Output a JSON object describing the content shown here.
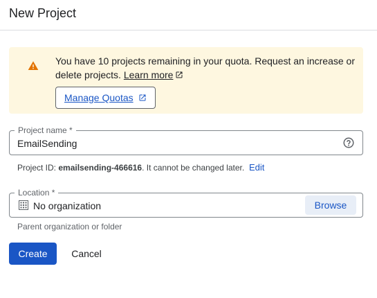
{
  "header": {
    "title": "New Project"
  },
  "quota_banner": {
    "message": "You have 10 projects remaining in your quota. Request an increase or delete projects.",
    "learn_more_label": "Learn more",
    "manage_quotas_label": "Manage Quotas",
    "icon": "warning-icon",
    "icon_color": "#e37400"
  },
  "project_name": {
    "label": "Project name *",
    "value": "EmailSending",
    "help_icon": "help-circle-icon"
  },
  "project_id": {
    "prefix": "Project ID: ",
    "id": "emailsending-466616",
    "suffix": ". It cannot be changed later.",
    "edit_label": "Edit"
  },
  "location": {
    "label": "Location *",
    "value": "No organization",
    "icon": "building-icon",
    "browse_label": "Browse",
    "hint": "Parent organization or folder"
  },
  "actions": {
    "create_label": "Create",
    "cancel_label": "Cancel"
  },
  "colors": {
    "accent": "#1a56c5",
    "banner_background": "#fef7e0"
  }
}
